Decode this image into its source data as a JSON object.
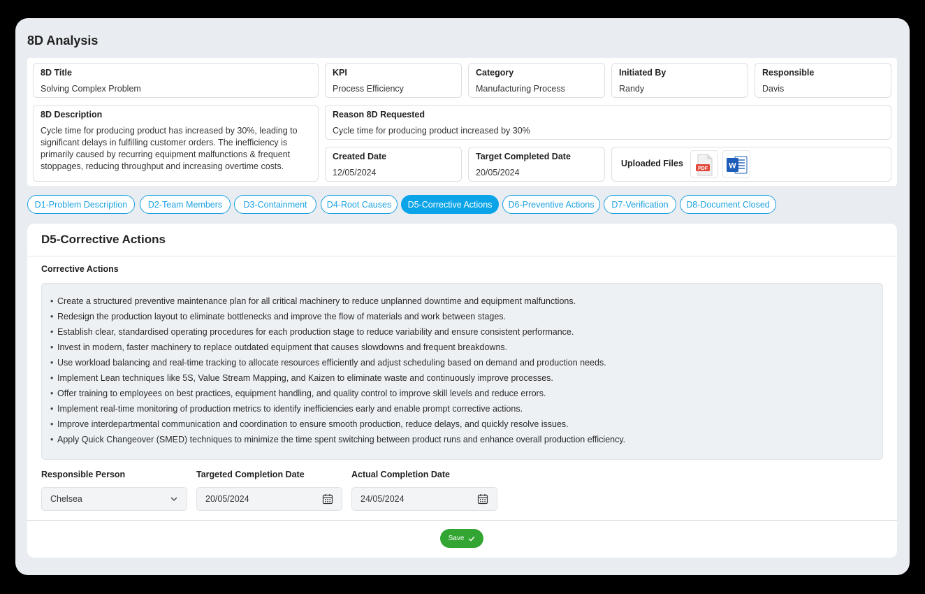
{
  "page_title": "8D Analysis",
  "info": {
    "title": {
      "label": "8D Title",
      "value": "Solving Complex Problem"
    },
    "kpi": {
      "label": "KPI",
      "value": "Process Efficiency"
    },
    "category": {
      "label": "Category",
      "value": "Manufacturing Process"
    },
    "initiated_by": {
      "label": "Initiated By",
      "value": "Randy"
    },
    "responsible": {
      "label": "Responsible",
      "value": "Davis"
    },
    "description": {
      "label": "8D Description",
      "value": "Cycle time for producing product has increased by 30%, leading to significant delays in fulfilling customer orders. The inefficiency is primarily caused by recurring equipment malfunctions & frequent stoppages, reducing throughput and increasing overtime costs."
    },
    "reason": {
      "label": "Reason 8D Requested",
      "value": "Cycle time for producing product increased by 30%"
    },
    "created_date": {
      "label": "Created Date",
      "value": "12/05/2024"
    },
    "target_completed_date": {
      "label": "Target Completed Date",
      "value": "20/05/2024"
    },
    "uploaded_files": {
      "label": "Uploaded Files",
      "files": [
        {
          "icon": "pdf-file-icon",
          "text": "PDF"
        },
        {
          "icon": "word-file-icon",
          "text": "W"
        }
      ]
    }
  },
  "tabs": [
    {
      "label": "D1-Problem Description"
    },
    {
      "label": "D2-Team Members"
    },
    {
      "label": "D3-Containment"
    },
    {
      "label": "D4-Root Causes"
    },
    {
      "label": "D5-Corrective Actions",
      "active": true
    },
    {
      "label": "D6-Preventive Actions"
    },
    {
      "label": "D7-Verification"
    },
    {
      "label": "D8-Document Closed"
    }
  ],
  "main": {
    "title": "D5-Corrective Actions",
    "section_label": "Corrective Actions",
    "actions": [
      "Create a structured preventive maintenance plan for all critical machinery to reduce unplanned downtime and equipment malfunctions.",
      "Redesign the production layout to eliminate bottlenecks and improve the flow of materials and work between stages.",
      "Establish clear, standardised operating procedures for each production stage to reduce variability and ensure consistent performance.",
      "Invest in modern, faster machinery to replace outdated equipment that causes slowdowns and frequent breakdowns.",
      "Use workload balancing and real-time tracking to allocate resources efficiently and adjust scheduling based on demand and production needs.",
      "Implement Lean techniques like 5S, Value Stream Mapping, and Kaizen to eliminate waste and continuously improve processes.",
      "Offer training to employees on best practices, equipment handling, and quality control to improve skill levels and reduce errors.",
      "Implement real-time monitoring of production metrics to identify inefficiencies early and enable prompt corrective actions.",
      "Improve interdepartmental communication and coordination to ensure smooth production, reduce delays, and quickly resolve issues.",
      "Apply Quick Changeover (SMED) techniques to minimize the time spent switching between product runs and enhance overall production efficiency."
    ],
    "responsible_person": {
      "label": "Responsible Person",
      "value": "Chelsea"
    },
    "targeted_completion_date": {
      "label": "Targeted Completion Date",
      "value": "20/05/2024"
    },
    "actual_completion_date": {
      "label": "Actual Completion Date",
      "value": "24/05/2024"
    },
    "save_label": "Save"
  },
  "colors": {
    "accent": "#0ba4e8",
    "save": "#33a532",
    "pdf": "#e2493a",
    "word": "#1e5db8"
  }
}
